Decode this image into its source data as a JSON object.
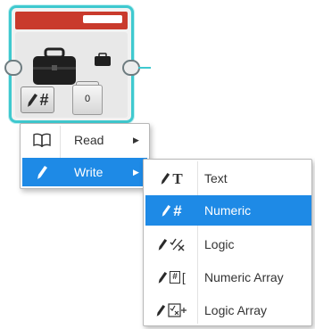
{
  "block": {
    "port_value": "0"
  },
  "main_menu": {
    "items": [
      {
        "label": "Read",
        "icon": "book-icon"
      },
      {
        "label": "Write",
        "icon": "pencil-icon"
      }
    ]
  },
  "write_submenu": {
    "items": [
      {
        "label": "Text",
        "icon": "text-T-icon"
      },
      {
        "label": "Numeric",
        "icon": "numeric-hash-icon"
      },
      {
        "label": "Logic",
        "icon": "logic-check-x-icon"
      },
      {
        "label": "Numeric Array",
        "icon": "numeric-array-icon"
      },
      {
        "label": "Logic Array",
        "icon": "logic-array-icon"
      }
    ]
  },
  "colors": {
    "block_outline": "#3fc9cf",
    "header_red": "#c93a2c",
    "selection_blue": "#1e8ae6"
  }
}
